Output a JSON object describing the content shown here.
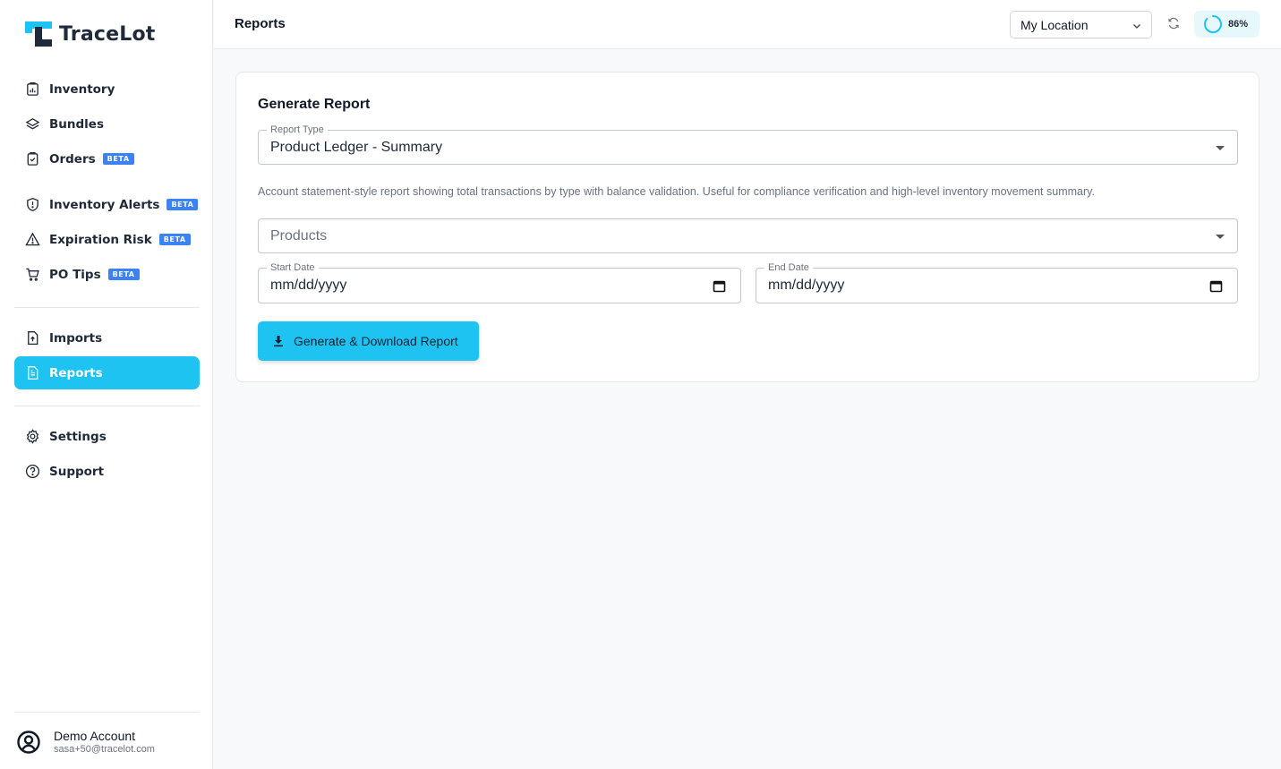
{
  "app": {
    "name": "TraceLot"
  },
  "sidebar": {
    "items": [
      {
        "label": "Inventory",
        "icon": "inventory-icon"
      },
      {
        "label": "Bundles",
        "icon": "layers-icon"
      },
      {
        "label": "Orders",
        "icon": "clipboard-icon",
        "badge": "BETA"
      },
      {
        "label": "Inventory Alerts",
        "icon": "shield-alert-icon",
        "badge": "BETA"
      },
      {
        "label": "Expiration Risk",
        "icon": "warning-icon",
        "badge": "BETA"
      },
      {
        "label": "PO Tips",
        "icon": "cart-icon",
        "badge": "BETA"
      },
      {
        "label": "Imports",
        "icon": "file-upload-icon"
      },
      {
        "label": "Reports",
        "icon": "file-report-icon",
        "active": true
      },
      {
        "label": "Settings",
        "icon": "gear-icon"
      },
      {
        "label": "Support",
        "icon": "help-icon"
      }
    ],
    "user": {
      "name": "Demo Account",
      "email": "sasa+50@tracelot.com"
    }
  },
  "header": {
    "title": "Reports",
    "location": "My Location",
    "progress_label": "86%",
    "progress_value": 0.86
  },
  "report": {
    "title": "Generate Report",
    "report_type_label": "Report Type",
    "report_type_value": "Product Ledger - Summary",
    "description": "Account statement-style report showing total transactions by type with balance validation. Useful for compliance verification and high-level inventory movement summary.",
    "products_placeholder": "Products",
    "start_date_label": "Start Date",
    "start_date_value": "mm/dd/yyyy",
    "end_date_label": "End Date",
    "end_date_value": "mm/dd/yyyy",
    "generate_button": "Generate & Download Report"
  },
  "colors": {
    "accent": "#1ec3f2",
    "badge": "#3b82f6",
    "brand_dark": "#1f2a3a"
  }
}
